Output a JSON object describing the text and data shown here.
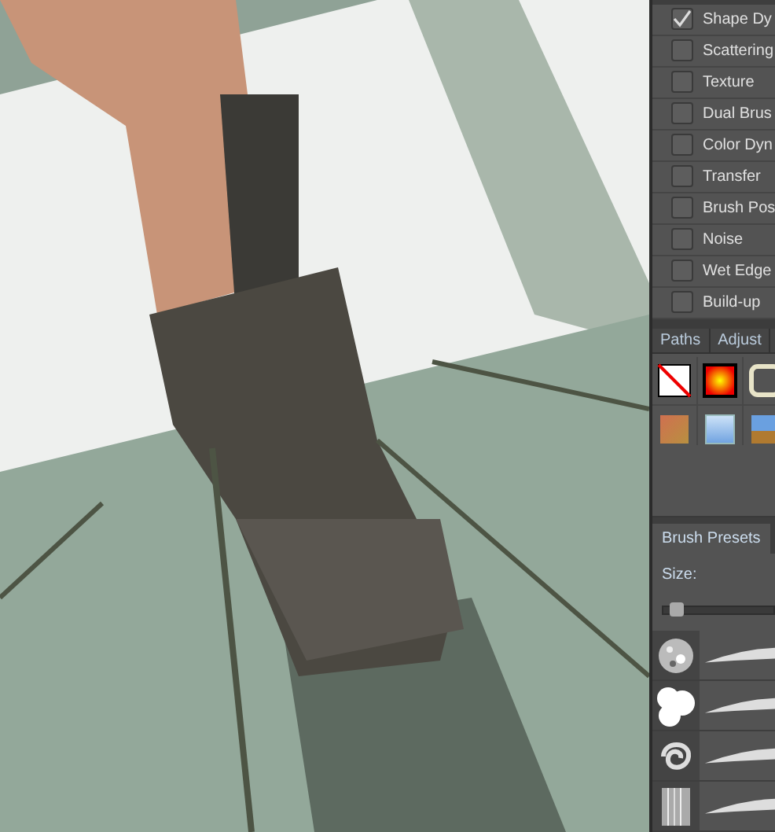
{
  "brush_options": [
    {
      "label": "Shape Dy",
      "checked": true
    },
    {
      "label": "Scattering",
      "checked": false
    },
    {
      "label": "Texture",
      "checked": false
    },
    {
      "label": "Dual Brus",
      "checked": false
    },
    {
      "label": "Color Dyn",
      "checked": false
    },
    {
      "label": "Transfer",
      "checked": false
    },
    {
      "label": "Brush Pos",
      "checked": false
    },
    {
      "label": "Noise",
      "checked": false
    },
    {
      "label": "Wet Edge",
      "checked": false
    },
    {
      "label": "Build-up",
      "checked": false
    }
  ],
  "tabs": [
    {
      "label": "Paths",
      "selected": false
    },
    {
      "label": "Adjust",
      "selected": false
    }
  ],
  "styles": [
    {
      "kind": "none"
    },
    {
      "kind": "glow"
    },
    {
      "kind": "outline"
    },
    {
      "kind": "sunset"
    },
    {
      "kind": "sky"
    },
    {
      "kind": "landscape"
    }
  ],
  "brush_presets": {
    "tab": "Brush Presets",
    "size_label": "Size:",
    "size": {
      "level": 0.05
    },
    "tips": [
      {
        "kind": "spatter"
      },
      {
        "kind": "cloud"
      },
      {
        "kind": "swirl"
      },
      {
        "kind": "bristle"
      }
    ]
  }
}
